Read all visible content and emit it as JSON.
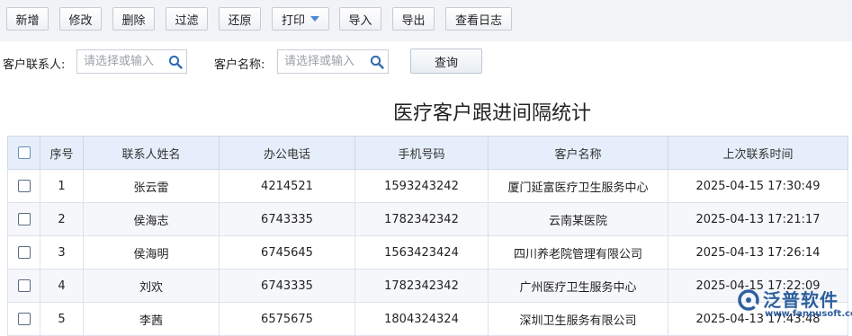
{
  "toolbar": {
    "add": "新增",
    "edit": "修改",
    "delete": "删除",
    "filter": "过滤",
    "restore": "还原",
    "print": "打印",
    "import": "导入",
    "export": "导出",
    "view_log": "查看日志"
  },
  "filters": {
    "contact_label": "客户联系人:",
    "contact_placeholder": "请选择或输入",
    "customer_label": "客户名称:",
    "customer_placeholder": "请选择或输入",
    "query": "查询"
  },
  "report": {
    "title": "医疗客户跟进间隔统计"
  },
  "table": {
    "columns": [
      "序号",
      "联系人姓名",
      "办公电话",
      "手机号码",
      "客户名称",
      "上次联系时间"
    ],
    "rows": [
      {
        "no": "1",
        "name": "张云雷",
        "office": "4214521",
        "mobile": "1593243242",
        "customer": "厦门延富医疗卫生服务中心",
        "last_contact": "2025-04-15 17:30:49",
        "highlight": false
      },
      {
        "no": "2",
        "name": "侯海志",
        "office": "6743335",
        "mobile": "1782342342",
        "customer": "云南某医院",
        "last_contact": "2025-04-13 17:21:17",
        "highlight": false
      },
      {
        "no": "3",
        "name": "侯海明",
        "office": "6745645",
        "mobile": "1563423424",
        "customer": "四川养老院管理有限公司",
        "last_contact": "2025-04-13 17:26:14",
        "highlight": true
      },
      {
        "no": "4",
        "name": "刘欢",
        "office": "6743335",
        "mobile": "1782342342",
        "customer": "广州医疗卫生服务中心",
        "last_contact": "2025-04-15 17:22:09",
        "highlight": false
      },
      {
        "no": "5",
        "name": "李茜",
        "office": "6575675",
        "mobile": "1804324324",
        "customer": "深圳卫生服务有限公司",
        "last_contact": "2025-04-13 17:43:48",
        "highlight": false
      }
    ]
  },
  "watermark": {
    "brand": "泛普软件",
    "site": "www.fanpusoft.com"
  },
  "colors": {
    "link": "#3b7bc3",
    "highlight": "#d9822b",
    "header_bg": "#e5eefa",
    "toolbar_bg": "#f1f3f6"
  }
}
